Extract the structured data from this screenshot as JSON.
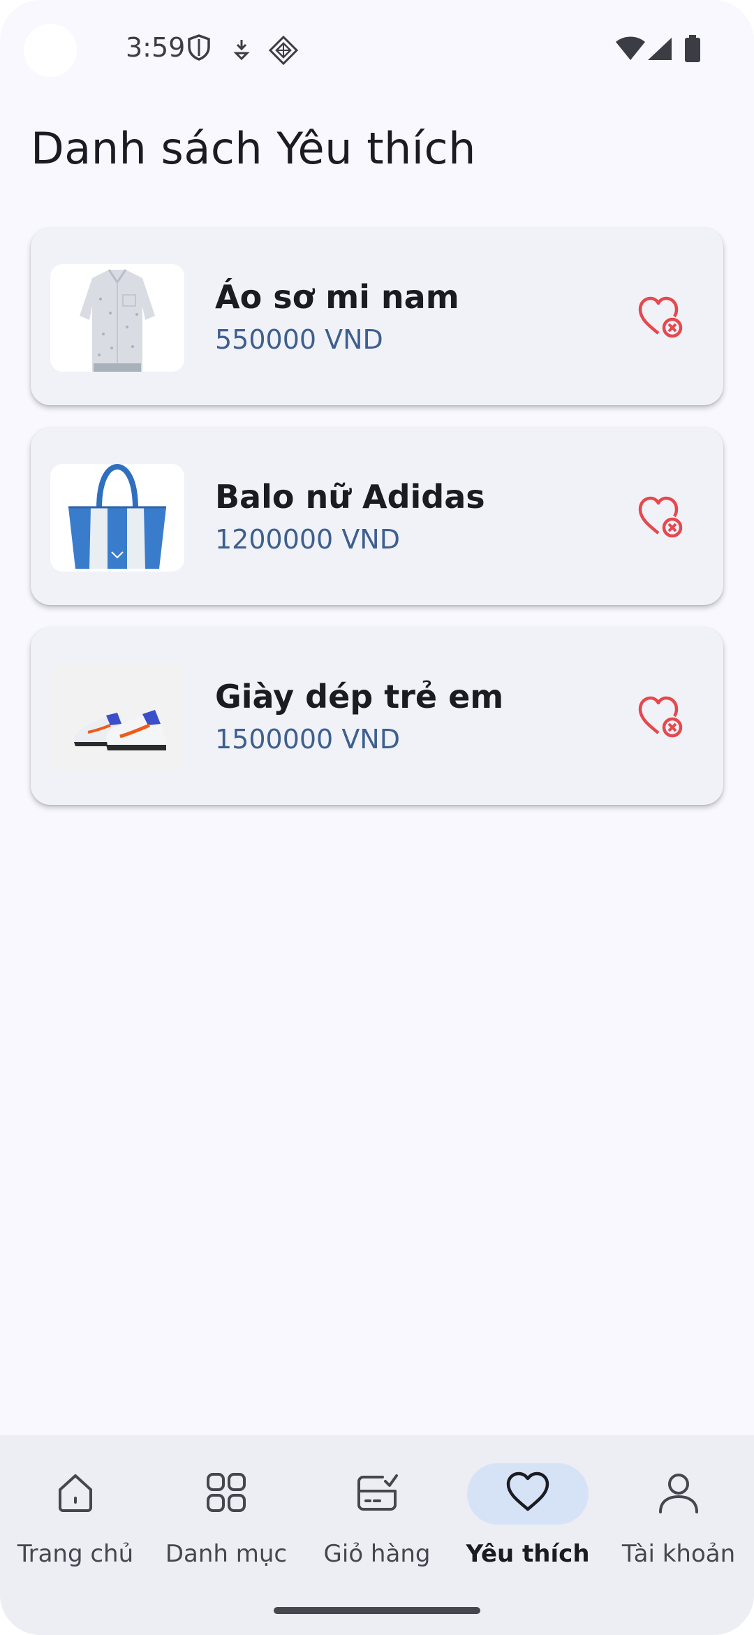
{
  "status_bar": {
    "time": "3:59",
    "left_icons": [
      "shield-icon",
      "download-icon",
      "app-diamond-icon"
    ],
    "right_icons": [
      "wifi-icon",
      "signal-icon",
      "battery-icon"
    ]
  },
  "page": {
    "title": "Danh sách Yêu thích"
  },
  "wishlist": {
    "items": [
      {
        "name": "Áo sơ mi nam",
        "price": "550000 VND",
        "image": "shirt-image"
      },
      {
        "name": "Balo nữ Adidas",
        "price": "1200000 VND",
        "image": "tote-bag-image"
      },
      {
        "name": "Giày dép trẻ em",
        "price": "1500000 VND",
        "image": "shoes-image"
      }
    ],
    "remove_icon": "heart-remove-icon"
  },
  "bottom_nav": {
    "items": [
      {
        "label": "Trang chủ",
        "icon": "home-icon",
        "active": false
      },
      {
        "label": "Danh mục",
        "icon": "grid-icon",
        "active": false
      },
      {
        "label": "Giỏ hàng",
        "icon": "cart-list-icon",
        "active": false
      },
      {
        "label": "Yêu thích",
        "icon": "heart-icon",
        "active": true
      },
      {
        "label": "Tài khoản",
        "icon": "user-icon",
        "active": false
      }
    ]
  },
  "colors": {
    "background": "#f8f8fe",
    "card": "#f0f2f8",
    "price": "#3e5f8f",
    "remove": "#e5484d",
    "nav_active_pill": "#d6e3f7"
  }
}
